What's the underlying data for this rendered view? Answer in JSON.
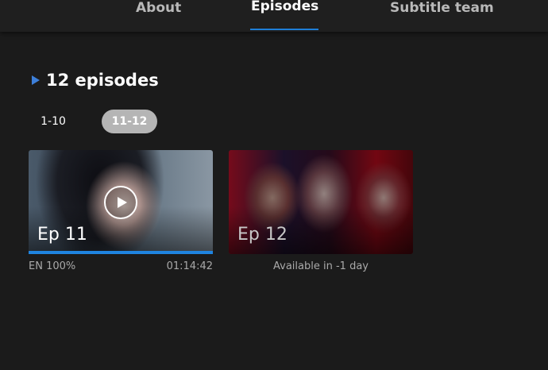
{
  "nav": {
    "tabs": [
      {
        "label": "About",
        "active": false
      },
      {
        "label": "Episodes",
        "active": true
      },
      {
        "label": "Subtitle team",
        "active": false
      }
    ],
    "accent_color": "#1e7fd8"
  },
  "section": {
    "title": "12 episodes",
    "marker_icon": "play-triangle-icon"
  },
  "ranges": [
    {
      "label": "1-10",
      "selected": false
    },
    {
      "label": "11-12",
      "selected": true
    }
  ],
  "episodes": [
    {
      "label": "Ep 11",
      "language": "EN 100%",
      "duration": "01:14:42",
      "progress": 1.0,
      "play_icon": "play-icon"
    },
    {
      "label": "Ep 12",
      "availability": "Available in -1 day"
    }
  ]
}
